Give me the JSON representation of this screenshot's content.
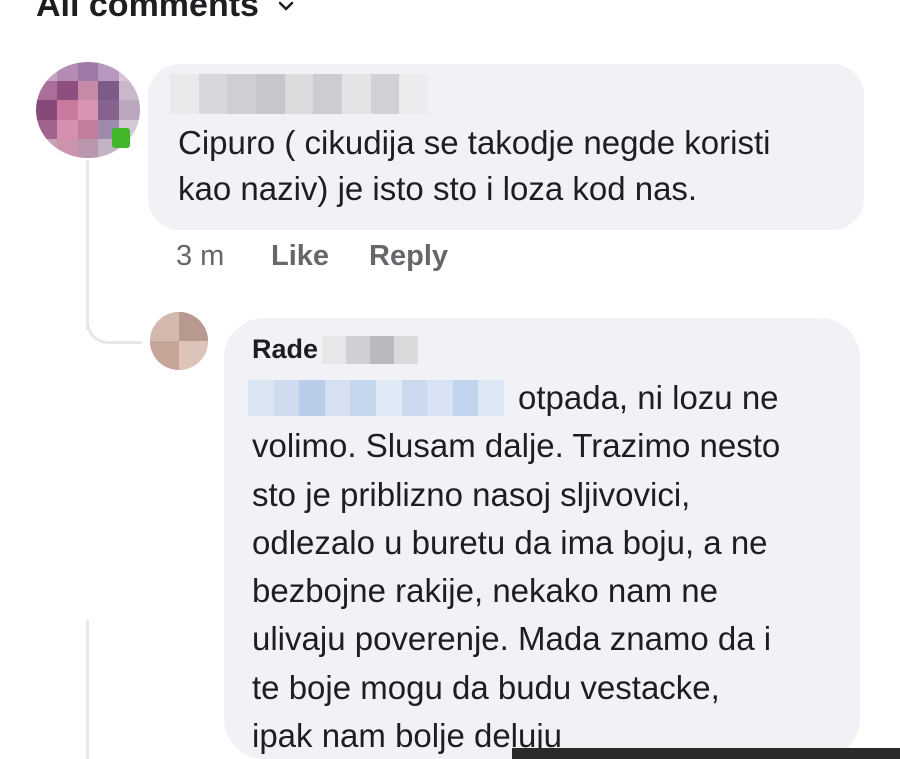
{
  "header": {
    "title": "All comments",
    "dropdown_icon": "chevron-down-icon"
  },
  "comment": {
    "author_obscured": true,
    "online": true,
    "text": "Cipuro ( cikudija se takodje negde koristi\nkao naziv) je isto sto i loza kod nas.",
    "time": "3 m",
    "like_label": "Like",
    "reply_label": "Reply"
  },
  "reply": {
    "author_visible": "Rade",
    "first_line": "otpada, ni lozu ne",
    "lines": [
      "volimo. Slusam dalje. Trazimo nesto",
      "sto je priblizno nasoj sljivovici,",
      "odlezalo u buretu da ima boju, a ne",
      "bezbojne rakije, nekako nam ne",
      "ulivaju poverenje. Mada znamo da i",
      "te boje mogu da budu vestacke,",
      "ipak nam bolje deluju"
    ]
  },
  "colors": {
    "bubble": "#f0f2f5",
    "meta_text": "#65676b",
    "online": "#42b72a"
  }
}
